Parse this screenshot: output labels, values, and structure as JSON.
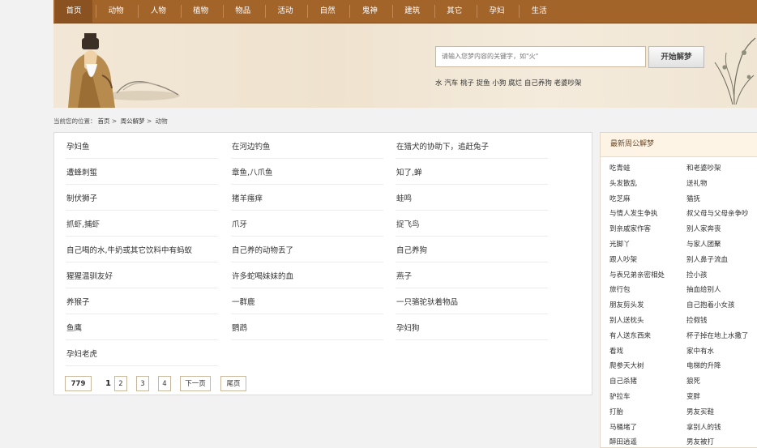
{
  "nav": [
    "首页",
    "动物",
    "人物",
    "植物",
    "物品",
    "活动",
    "自然",
    "鬼神",
    "建筑",
    "其它",
    "孕妇",
    "生活"
  ],
  "search": {
    "placeholder": "请输入您梦内容的关键字，如\"火\"",
    "button": "开始解梦"
  },
  "hot_keywords": [
    "水",
    "汽车",
    "桃子",
    "捉鱼",
    "小狗",
    "腐烂",
    "自己养狗",
    "老婆吵架"
  ],
  "breadcrumb": {
    "prefix": "当前您的位置：",
    "items": [
      "首页",
      "周公解梦",
      "动物"
    ],
    "sep": ">"
  },
  "list": [
    [
      "孕妇鱼",
      "在河边钓鱼",
      "在猎犬的协助下，追赶兔子"
    ],
    [
      "遭蜂刺蜇",
      "章鱼,八爪鱼",
      "知了,蝉"
    ],
    [
      "制伏狮子",
      "猪羊瘙痒",
      "蛙鸣"
    ],
    [
      "抓虾,捕虾",
      "爪牙",
      "捉飞鸟"
    ],
    [
      "自己喝的水,牛奶或其它饮料中有蚂蚁",
      "自己养的动物丢了",
      "自己养狗"
    ],
    [
      "猩猩温驯友好",
      "许多蛇喝妹妹的血",
      "燕子"
    ],
    [
      "养猴子",
      "一群鹿",
      "一只骆驼驮着物品"
    ],
    [
      "鱼鹰",
      "鹦鹉",
      "孕妇狗"
    ],
    [
      "孕妇老虎",
      "",
      ""
    ]
  ],
  "pager": {
    "total": "779",
    "current": "1",
    "pages": [
      "2",
      "3",
      "4"
    ],
    "next": "下一页",
    "last": "尾页"
  },
  "sidebar": {
    "title": "最新周公解梦",
    "left": [
      "吃青蛙",
      "头发散乱",
      "吃芝麻",
      "与情人发生争执",
      "到亲戚家作客",
      "光脚丫",
      "跟人吵架",
      "与表兄弟亲密相处",
      "旅行包",
      "朋友剪头发",
      "别人送枕头",
      "有人送东西来",
      "看戏",
      "爬参天大树",
      "自己杀猪",
      "驴拉车",
      "打胎",
      "马桶堵了",
      "醉田逍遥"
    ],
    "right": [
      "和老婆吵架",
      "送礼物",
      "猫抚",
      "叔父母与父母亲争吵",
      "别人家奔丧",
      "与家人团聚",
      "别人鼻子流血",
      "捡小孩",
      "抽血给别人",
      "自己抱着小女孩",
      "捡假钱",
      "杯子掉在地上水撒了",
      "家中有水",
      "电梯的升降",
      "狼死",
      "变胖",
      "男友买鞋",
      "拿别人的钱",
      "男友被打"
    ]
  }
}
